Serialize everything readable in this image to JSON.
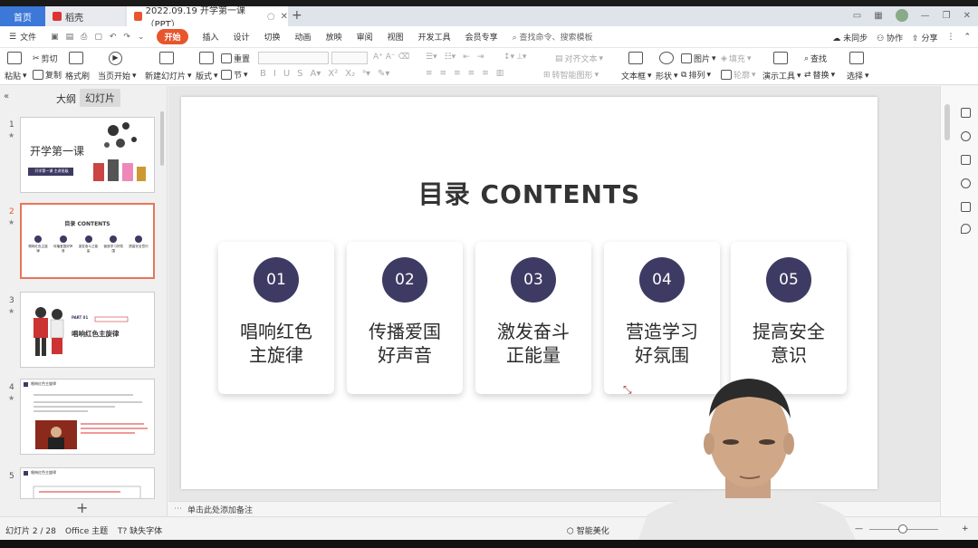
{
  "tabs": {
    "home": "首页",
    "store": "稻壳",
    "doc": "2022.09.19 开学第一课（PPT）"
  },
  "menu": {
    "file": "文件",
    "items": [
      "开始",
      "插入",
      "设计",
      "切换",
      "动画",
      "放映",
      "审阅",
      "视图",
      "开发工具",
      "会员专享"
    ],
    "search": "查找命令、搜索模板",
    "sync": "未同步",
    "collab": "协作",
    "share": "分享"
  },
  "ribbon": {
    "paste": "粘贴",
    "cut": "剪切",
    "copy": "复制",
    "format_painter": "格式刷",
    "play_from_current": "当页开始",
    "new_slide": "新建幻灯片",
    "layout": "版式",
    "section": "节",
    "reset": "重置",
    "text_box": "文本框",
    "shape": "形状",
    "arrange": "排列",
    "picture": "图片",
    "fill": "填充",
    "outline": "轮廓",
    "presentation_tools": "演示工具",
    "find": "查找",
    "replace": "替换",
    "select": "选择",
    "align_text": "对齐文本",
    "convert_smartart": "转智能图形"
  },
  "left_panel": {
    "outline_tab": "大纲",
    "slides_tab": "幻灯片",
    "thumbnails": [
      {
        "num": "1",
        "title": "开学第一课",
        "sub": "开学第一课 主讲班级"
      },
      {
        "num": "2",
        "title": "目录 CONTENTS",
        "items": [
          "唱响红色主旋律",
          "传播爱国好声音",
          "激发奋斗正能量",
          "营造学习好氛围",
          "提高安全意识"
        ]
      },
      {
        "num": "3",
        "tag": "PART 01",
        "title": "唱响红色主旋律"
      },
      {
        "num": "4",
        "title": "唱响红色主旋律"
      },
      {
        "num": "5",
        "title": "唱响红色主旋律"
      }
    ]
  },
  "slide": {
    "title": "目录 CONTENTS",
    "cards": [
      {
        "num": "01",
        "line1": "唱响红色",
        "line2": "主旋律"
      },
      {
        "num": "02",
        "line1": "传播爱国",
        "line2": "好声音"
      },
      {
        "num": "03",
        "line1": "激发奋斗",
        "line2": "正能量"
      },
      {
        "num": "04",
        "line1": "营造学习",
        "line2": "好氛围"
      },
      {
        "num": "05",
        "line1": "提高安全",
        "line2": "意识"
      }
    ]
  },
  "notes_placeholder": "单击此处添加备注",
  "status": {
    "slide_counter": "幻灯片 2 / 28",
    "theme": "Office 主题",
    "missing_fonts": "缺失字体",
    "smart_beautify": "智能美化"
  },
  "colors": {
    "accent": "#e8552d",
    "circle": "#3d3b63",
    "tab_home": "#3c78d8"
  }
}
